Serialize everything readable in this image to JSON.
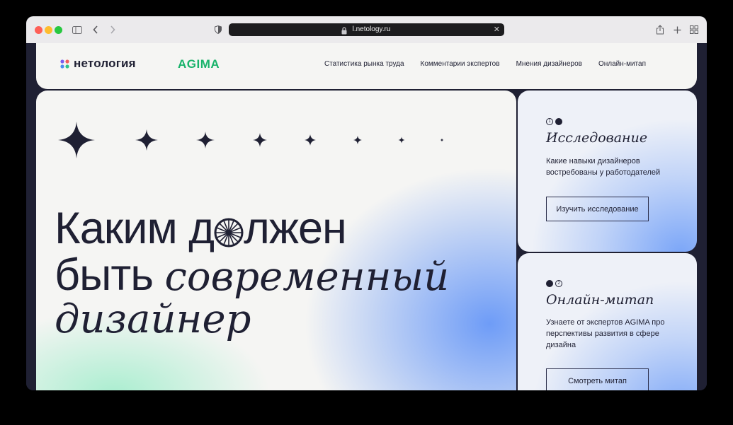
{
  "browser": {
    "url": "l.netology.ru"
  },
  "header": {
    "logo_text": "нетология",
    "partner_logo": "AGIMA",
    "nav": [
      {
        "label": "Статистика рынка труда"
      },
      {
        "label": "Комментарии экспертов"
      },
      {
        "label": "Мнения дизайнеров"
      },
      {
        "label": "Онлайн-митап"
      }
    ]
  },
  "hero": {
    "line1_a": "Каким д",
    "line1_b": "лжен",
    "line2_a": "быть ",
    "line2_b": "современный",
    "line3": "дизайнер"
  },
  "cards": [
    {
      "step": "1",
      "title": "Исследование",
      "text": "Какие навыки дизайнеров востребованы у работодателей",
      "button": "Изучить исследование"
    },
    {
      "step": "2",
      "title": "Онлайн-митап",
      "text": "Узнаете от экспертов AGIMA про перспективы развития в сфере дизайна",
      "button": "Смотреть митап"
    }
  ],
  "colors": {
    "ink": "#1f2033",
    "brand_green": "#19b36b",
    "accent_blue": "#6e9cf7"
  },
  "icons": [
    "sidebar-icon",
    "back-icon",
    "forward-icon",
    "shield-icon",
    "lock-icon",
    "close-icon",
    "share-icon",
    "new-tab-icon",
    "tab-overview-icon",
    "sparkle-icon",
    "wheel-icon"
  ]
}
